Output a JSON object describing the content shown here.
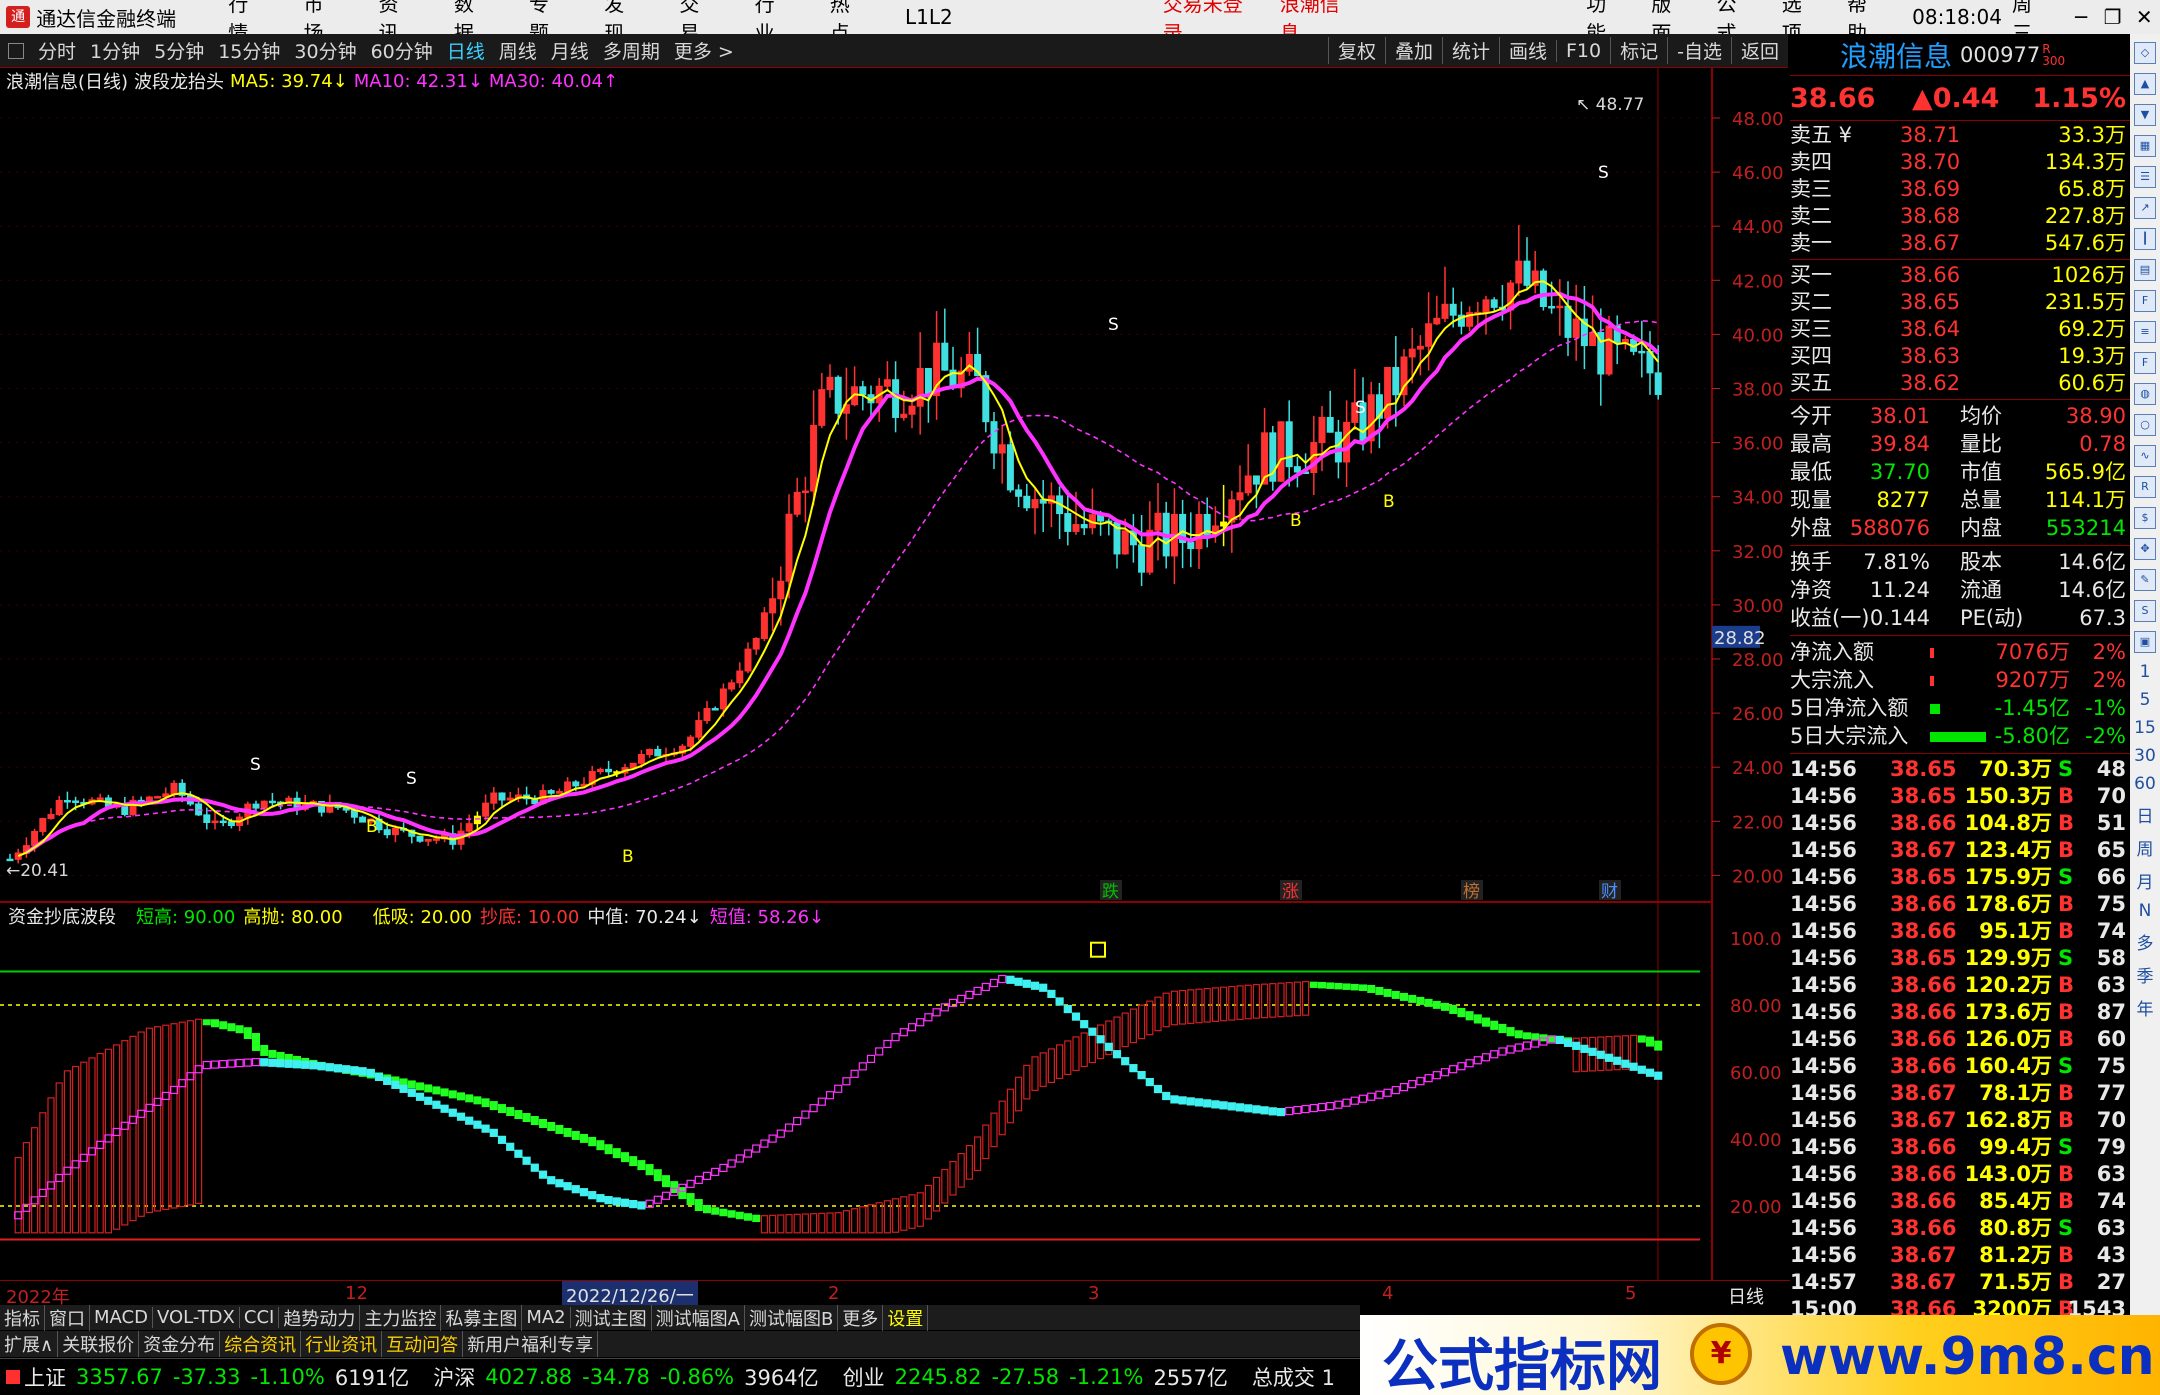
{
  "menubar": {
    "title": "通达信金融终端",
    "items": [
      "行情",
      "市场",
      "资讯",
      "数据",
      "专题",
      "发现",
      "交易",
      "行业",
      "热点",
      "L1L2"
    ],
    "warn1": "交易未登录",
    "warn2": "浪潮信息",
    "right": [
      "功能",
      "版面",
      "公式",
      "选项",
      "帮助"
    ],
    "time": "08:18:04",
    "weekday": "周三"
  },
  "toolbar": {
    "periods": [
      "分时",
      "1分钟",
      "5分钟",
      "15分钟",
      "30分钟",
      "60分钟",
      "日线",
      "周线",
      "月线",
      "多周期",
      "更多 >"
    ],
    "active": "日线",
    "right": [
      "复权",
      "叠加",
      "统计",
      "画线",
      "F10",
      "标记",
      "-自选",
      "返回"
    ]
  },
  "chartinfo": {
    "name": "浪潮信息(日线)",
    "formula": "波段龙抬头",
    "ma5": "MA5: 39.74↓",
    "ma10": "MA10: 42.31↓",
    "ma30": "MA30: 40.04↑"
  },
  "lowinfo": {
    "name": "资金抄底波段",
    "a": "短高: 90.00",
    "b": "高抛: 80.00",
    "c": "低吸: 20.00",
    "d": "抄底: 10.00",
    "e": "中值: 70.24↓",
    "f": "短值: 58.26↓"
  },
  "price_axis": [
    "48.00",
    "46.00",
    "44.00",
    "42.00",
    "40.00",
    "38.00",
    "36.00",
    "34.00",
    "32.00",
    "30.00",
    "28.00",
    "26.00",
    "24.00",
    "22.00",
    "20.00"
  ],
  "price_tag": "28.82",
  "ind_axis": [
    "100.0",
    "80.00",
    "60.00",
    "40.00",
    "20.00"
  ],
  "chart_marks": {
    "high": "48.77",
    "low": "20.41",
    "S": "S",
    "B": "B",
    "news": [
      "跌",
      "涨",
      "榜",
      "财"
    ]
  },
  "date_axis": [
    "2022年",
    "12",
    "2022/12/26/一",
    "2",
    "3",
    "4",
    "5",
    "日线"
  ],
  "rhead": {
    "name": "浪潮信息",
    "code": "000977",
    "r": "R",
    "n300": "300"
  },
  "quote": {
    "price": "38.66",
    "change": "▲0.44",
    "pct": "1.15%"
  },
  "asks": [
    [
      "卖五 ¥",
      "38.71",
      "33.3万"
    ],
    [
      "卖四",
      "38.70",
      "134.3万"
    ],
    [
      "卖三",
      "38.69",
      "65.8万"
    ],
    [
      "卖二",
      "38.68",
      "227.8万"
    ],
    [
      "卖一",
      "38.67",
      "547.6万"
    ]
  ],
  "bids": [
    [
      "买一",
      "38.66",
      "1026万"
    ],
    [
      "买二",
      "38.65",
      "231.5万"
    ],
    [
      "买三",
      "38.64",
      "69.2万"
    ],
    [
      "买四",
      "38.63",
      "19.3万"
    ],
    [
      "买五",
      "38.62",
      "60.6万"
    ]
  ],
  "stats": [
    [
      "今开",
      "38.01",
      "均价",
      "38.90"
    ],
    [
      "最高",
      "39.84",
      "量比",
      "0.78"
    ],
    [
      "最低",
      "37.70",
      "市值",
      "565.9亿"
    ],
    [
      "现量",
      "8277",
      "总量",
      "114.1万"
    ],
    [
      "外盘",
      "588076",
      "内盘",
      "553214"
    ]
  ],
  "stats2": [
    [
      "换手",
      "7.81%",
      "股本",
      "14.6亿"
    ],
    [
      "净资",
      "11.24",
      "流通",
      "14.6亿"
    ],
    [
      "收益(一)",
      "0.144",
      "PE(动)",
      "67.3"
    ]
  ],
  "flows": [
    [
      "净流入额",
      "7076万",
      "2%"
    ],
    [
      "大宗流入",
      "9207万",
      "2%"
    ],
    [
      "5日净流入额",
      "-1.45亿",
      "-1%"
    ],
    [
      "5日大宗流入",
      "-5.80亿",
      "-2%"
    ]
  ],
  "ticks": [
    [
      "14:56",
      "38.65",
      "70.3万",
      "S",
      "48"
    ],
    [
      "14:56",
      "38.65",
      "150.3万",
      "B",
      "70"
    ],
    [
      "14:56",
      "38.66",
      "104.8万",
      "B",
      "51"
    ],
    [
      "14:56",
      "38.67",
      "123.4万",
      "B",
      "65"
    ],
    [
      "14:56",
      "38.65",
      "175.9万",
      "S",
      "66"
    ],
    [
      "14:56",
      "38.66",
      "178.6万",
      "B",
      "75"
    ],
    [
      "14:56",
      "38.66",
      "95.1万",
      "B",
      "74"
    ],
    [
      "14:56",
      "38.65",
      "129.9万",
      "S",
      "58"
    ],
    [
      "14:56",
      "38.66",
      "120.2万",
      "B",
      "63"
    ],
    [
      "14:56",
      "38.66",
      "173.6万",
      "B",
      "87"
    ],
    [
      "14:56",
      "38.66",
      "126.0万",
      "B",
      "60"
    ],
    [
      "14:56",
      "38.66",
      "160.4万",
      "S",
      "75"
    ],
    [
      "14:56",
      "38.67",
      "78.1万",
      "B",
      "77"
    ],
    [
      "14:56",
      "38.67",
      "162.8万",
      "B",
      "70"
    ],
    [
      "14:56",
      "38.66",
      "99.4万",
      "S",
      "79"
    ],
    [
      "14:56",
      "38.66",
      "143.0万",
      "B",
      "63"
    ],
    [
      "14:56",
      "38.66",
      "85.4万",
      "B",
      "74"
    ],
    [
      "14:56",
      "38.66",
      "80.8万",
      "S",
      "63"
    ],
    [
      "14:56",
      "38.67",
      "81.2万",
      "B",
      "43"
    ],
    [
      "14:57",
      "38.67",
      "71.5万",
      "B",
      "27"
    ],
    [
      "15:00",
      "38.66",
      "3200万",
      "B",
      "1543"
    ]
  ],
  "sidebar_text": [
    "日",
    "周",
    "月",
    "N",
    "多",
    "季",
    "年"
  ],
  "bottomtabs": [
    "指标",
    "窗口",
    "MACD",
    "VOL-TDX",
    "CCI",
    "趋势动力",
    "主力监控",
    "私募主图",
    "MA2",
    "测试主图",
    "测试幅图A",
    "测试幅图B",
    "更多",
    "设置"
  ],
  "bottomtabs2": [
    "扩展∧",
    "关联报价",
    "资金分布",
    "综合资讯",
    "行业资讯",
    "互动问答",
    "新用户福利专享"
  ],
  "status": [
    [
      "上证",
      "3357.67",
      "-37.33",
      "-1.10%",
      "6191亿"
    ],
    [
      "沪深",
      "4027.88",
      "-34.78",
      "-0.86%",
      "3964亿"
    ],
    [
      "创业",
      "2245.82",
      "-27.58",
      "-1.21%",
      "2557亿"
    ]
  ],
  "status_tail": "总成交 1",
  "banner": {
    "t1": "公式指标网",
    "coin": "¥",
    "t2": "www.9m8.cn"
  },
  "colors": {
    "up": "#ff3232",
    "down": "#00e600",
    "ma5": "#ffff00",
    "ma10": "#ff33ff",
    "blue": "#1e9fff"
  }
}
